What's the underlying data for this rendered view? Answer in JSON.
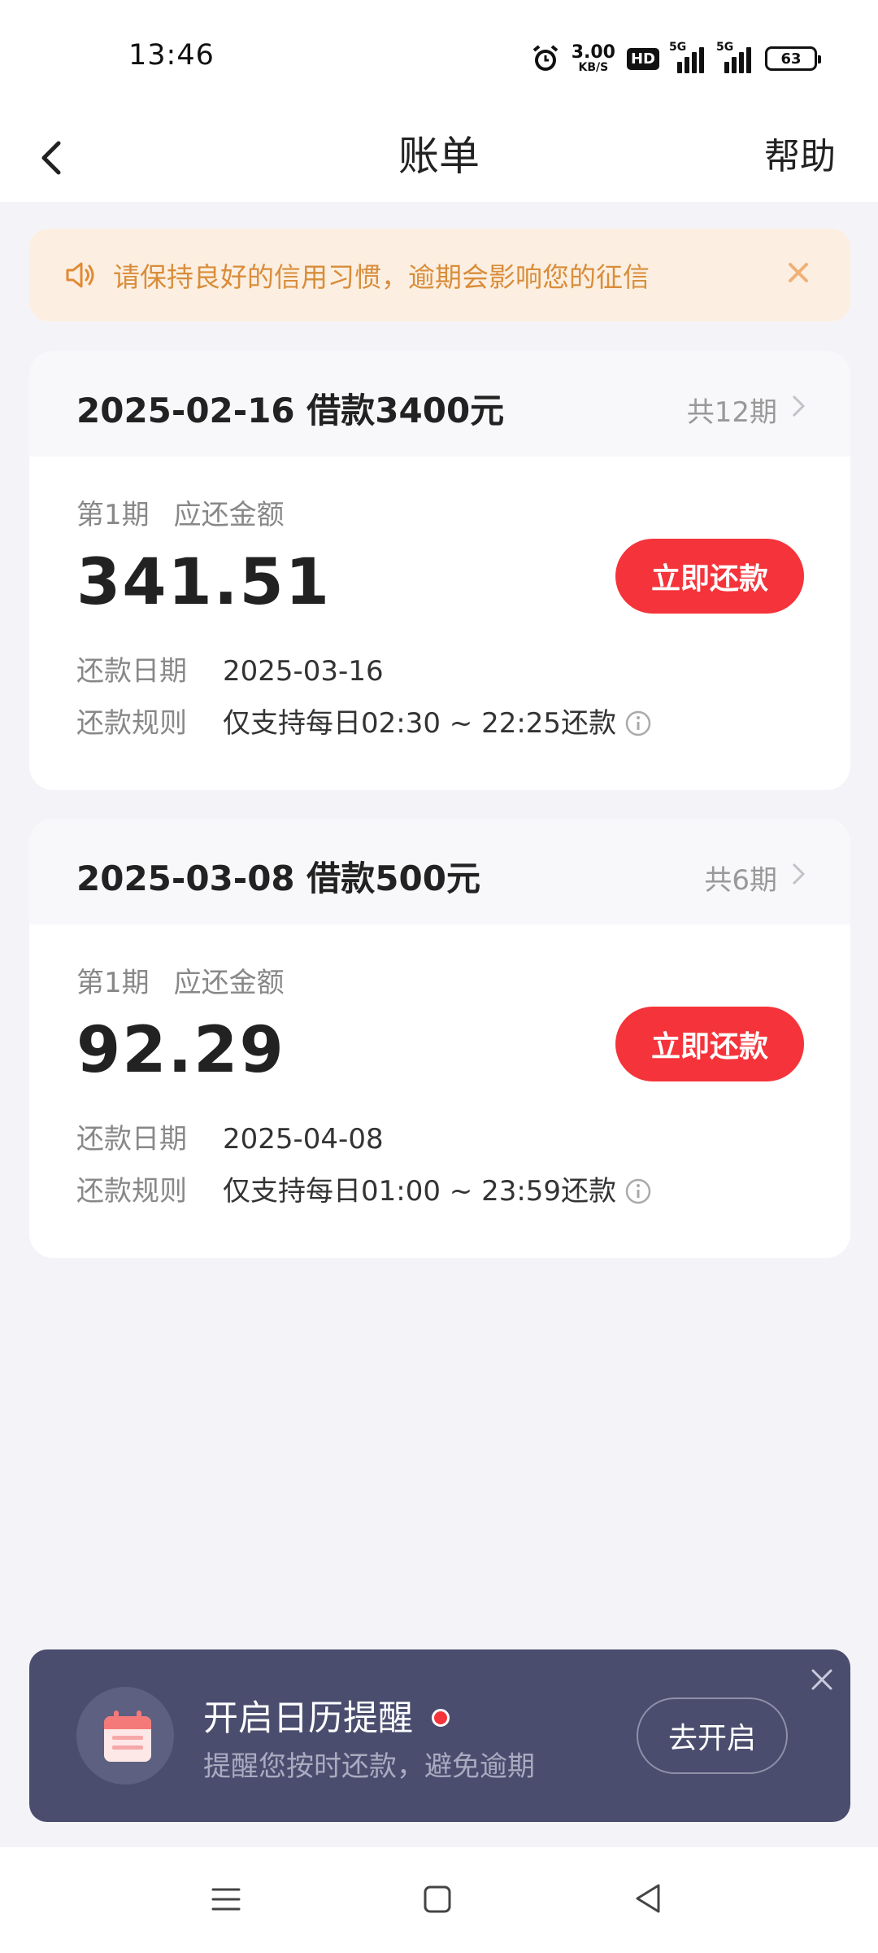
{
  "status_bar": {
    "time": "13:46",
    "net_speed_value": "3.00",
    "net_speed_unit": "KB/S",
    "hd_label": "HD",
    "signal1_label": "5G",
    "signal2_label": "5G",
    "battery": "63"
  },
  "header": {
    "title": "账单",
    "help_label": "帮助"
  },
  "notice": {
    "text": "请保持良好的信用习惯，逾期会影响您的征信",
    "icon": "speaker-icon"
  },
  "loans": [
    {
      "title": "2025-02-16 借款3400元",
      "periods": "共12期",
      "installment": "第1期",
      "due_label": "应还金额",
      "amount": "341.51",
      "pay_label": "立即还款",
      "date_key": "还款日期",
      "date_value": "2025-03-16",
      "rule_key": "还款规则",
      "rule_value": "仅支持每日02:30 ~ 22:25还款"
    },
    {
      "title": "2025-03-08 借款500元",
      "periods": "共6期",
      "installment": "第1期",
      "due_label": "应还金额",
      "amount": "92.29",
      "pay_label": "立即还款",
      "date_key": "还款日期",
      "date_value": "2025-04-08",
      "rule_key": "还款规则",
      "rule_value": "仅支持每日01:00 ~ 23:59还款"
    }
  ],
  "reminder": {
    "title": "开启日历提醒",
    "subtitle": "提醒您按时还款，避免逾期",
    "button_label": "去开启"
  },
  "colors": {
    "accent_red": "#f5333a",
    "notice_bg": "#fcefe1",
    "notice_text": "#d98d3a",
    "banner_bg": "#4a4d6e"
  }
}
